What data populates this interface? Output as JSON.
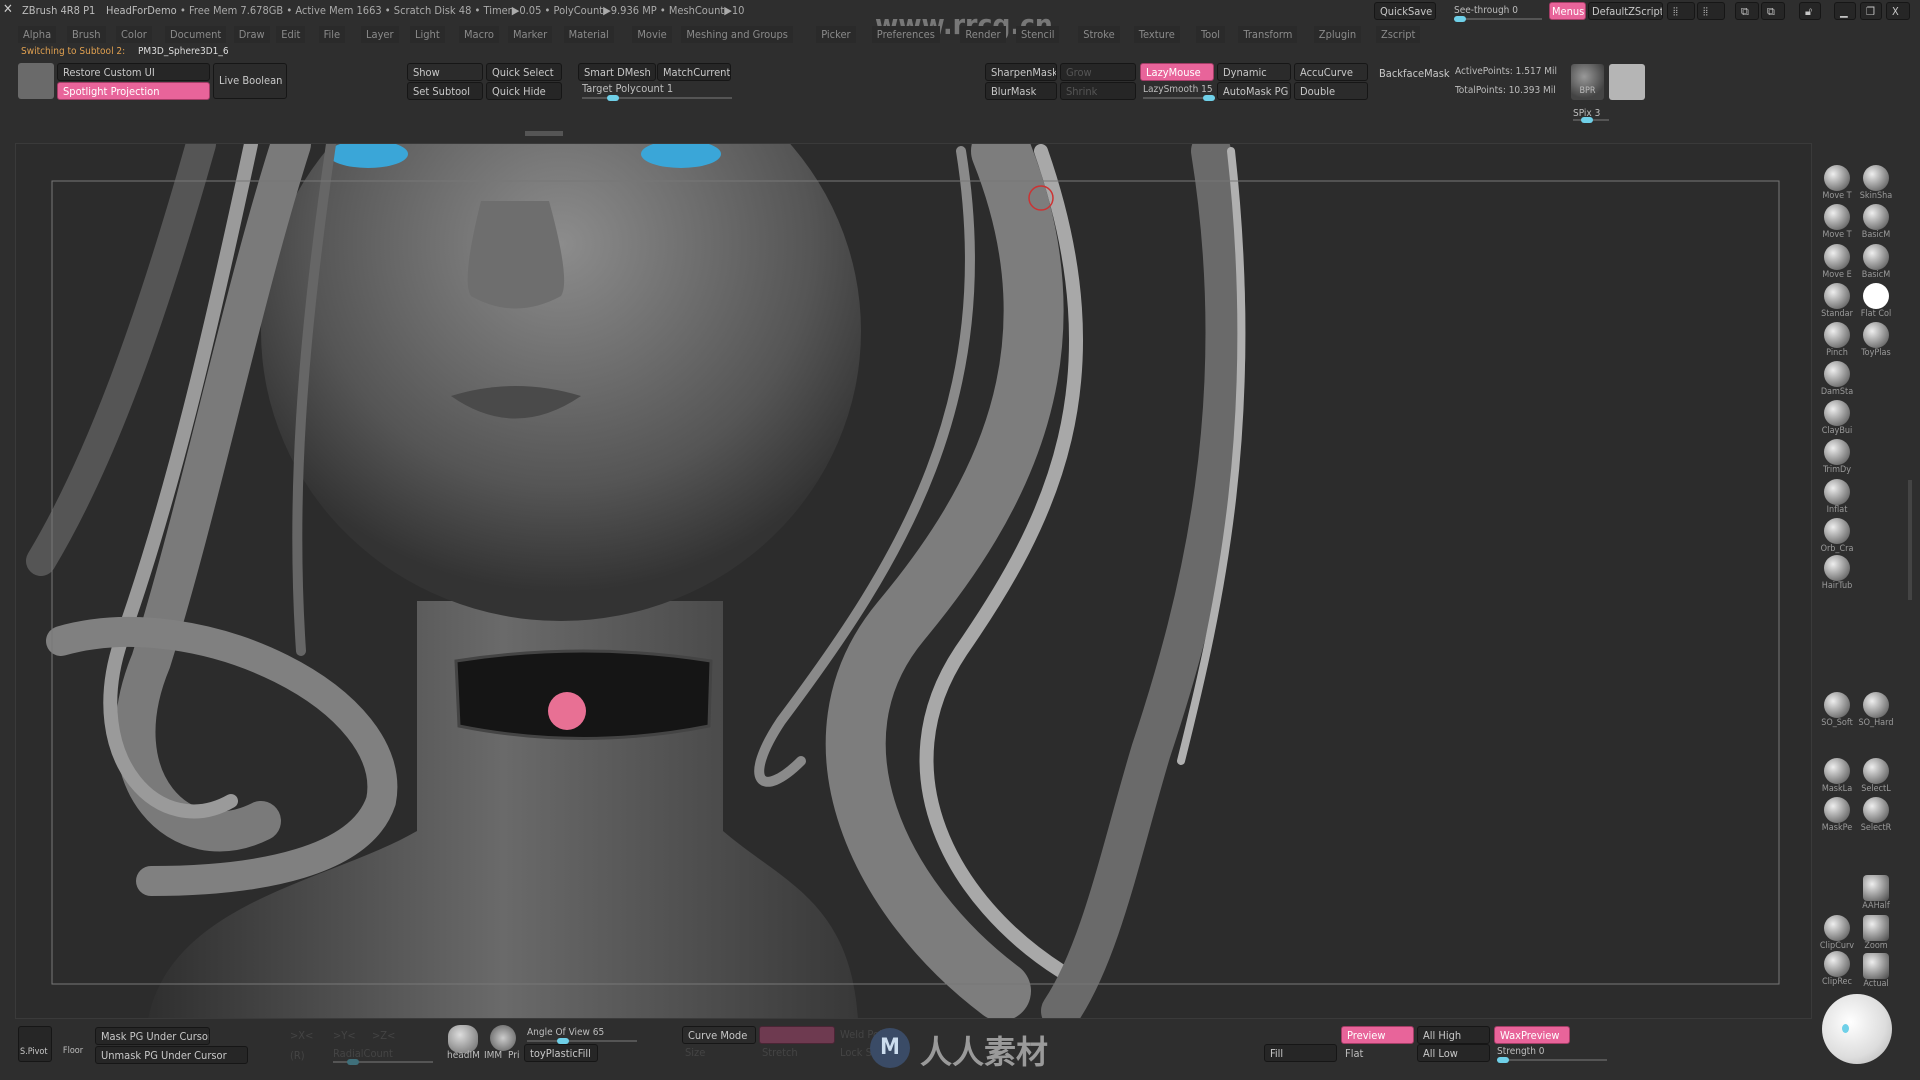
{
  "titlebar": {
    "app": "ZBrush 4R8 P1",
    "project": "HeadForDemo",
    "stats": "• Free Mem 7.678GB • Active Mem 1663 • Scratch Disk 48 •  Timer▶0.05 • PolyCount▶9.936 MP  • MeshCount▶10",
    "quicksave": "QuickSave",
    "see_through": "See-through  0",
    "see_through_value": 0,
    "menus": "Menus",
    "default_zscript": "DefaultZScript"
  },
  "menubar": [
    "Alpha",
    "Brush",
    "Color",
    "Document",
    "Draw",
    "Edit",
    "File",
    "Layer",
    "Light",
    "Macro",
    "Marker",
    "Material",
    "Movie",
    "Meshing and Groups",
    "Picker",
    "Preferences",
    "Render",
    "Stencil",
    "Stroke",
    "Texture",
    "Tool",
    "Transform",
    "Zplugin",
    "Zscript"
  ],
  "watermark": "www.rrcg.cn",
  "notice": {
    "label": "Switching to Subtool 2:",
    "value": "PM3D_Sphere3D1_6"
  },
  "toolbar": {
    "restore_custom_ui": "Restore Custom UI",
    "spotlight_projection": "Spotlight Projection",
    "live_boolean": "Live Boolean",
    "show": "Show",
    "quick_select": "Quick Select",
    "smart_dmesh": "Smart DMesh",
    "match_current": "MatchCurrent",
    "set_subtool": "Set Subtool",
    "quick_hide": "Quick Hide",
    "target_polycount": "Target Polycount 1",
    "sharpen_mask": "SharpenMask",
    "grow": "Grow",
    "lazy_mouse": "LazyMouse",
    "dynamic": "Dynamic",
    "accu_curve": "AccuCurve",
    "backface_mask": "BackfaceMask",
    "blur_mask": "BlurMask",
    "shrink": "Shrink",
    "lazy_smooth": "LazySmooth 15",
    "automask_pg": "AutoMask PG",
    "double": "Double",
    "active_points": "ActivePoints: 1.517 Mil",
    "total_points": "TotalPoints: 10.393 Mil",
    "bpr": "BPR",
    "spix": "SPix 3"
  },
  "brushes": [
    "Move T",
    "SkinSha",
    "Move T",
    "BasicM",
    "Move E",
    "BasicM",
    "Standar",
    "Flat Col",
    "Pinch",
    "ToyPlas",
    "DamSta",
    "ClayBui",
    "TrimDy",
    "Inflat",
    "Orb_Cra",
    "HairTub"
  ],
  "shelf2": {
    "so_soft": "SO_Soft",
    "so_hard": "SO_Hard",
    "mask_lasso": "MaskLa",
    "select_lasso": "SelectL",
    "mask_pen": "MaskPe",
    "select_rect": "SelectR",
    "aahalf": "AAHalf",
    "clip_curve": "ClipCurv",
    "zoom": "Zoom",
    "clip_rect": "ClipRec",
    "actual": "Actual"
  },
  "bottombar": {
    "spivot": "S.Pivot",
    "floor": "Floor",
    "mask_pg": "Mask PG Under Cursor",
    "unmask_pg": "Unmask PG Under Cursor",
    "x": ">X<",
    "y": ">Y<",
    "z": ">Z<",
    "r": "(R)",
    "radial_count": "RadialCount",
    "head_im": "headIM",
    "imm": "IMM",
    "pri": "Pri",
    "angle_of_view": "Angle Of View 65",
    "material": "toyPlasticFill",
    "curve_mode": "Curve Mode",
    "size": "Size",
    "stretch": "Stretch",
    "weld": "Weld Points",
    "lock": "Lock Start",
    "fill": "Fill",
    "flat": "Flat",
    "preview": "Preview",
    "all_high": "All High",
    "all_low": "All Low",
    "wax_preview": "WaxPreview",
    "strength": "Strength 0",
    "logo_text": "人人素材"
  },
  "colors": {
    "accent_pink": "#e8649a",
    "slider_cyan": "#6fd0e8",
    "background": "#2e2e2e",
    "gem": "#e87094",
    "eyes": "#3aa6d8"
  }
}
